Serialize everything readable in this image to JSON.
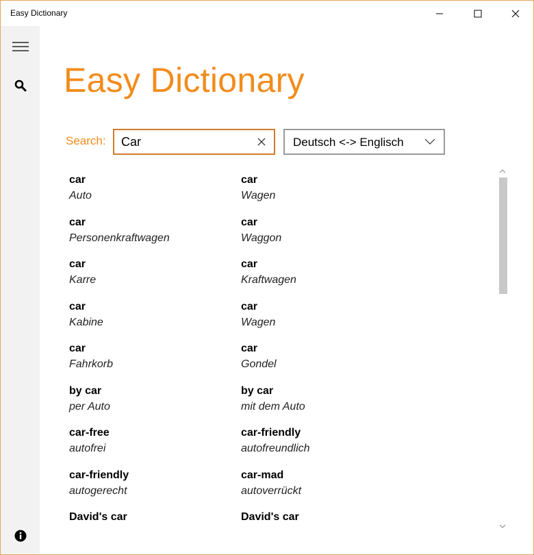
{
  "window": {
    "title": "Easy Dictionary"
  },
  "app": {
    "heading": "Easy Dictionary",
    "accent_color": "#f28c1c"
  },
  "sidebar": {
    "menu_icon": "hamburger-menu-icon",
    "search_icon": "search-icon",
    "info_icon": "info-icon"
  },
  "search": {
    "label": "Search:",
    "value": "Car",
    "clear_icon": "close-icon"
  },
  "language": {
    "selected": "Deutsch <-> Englisch"
  },
  "results": [
    {
      "left_term": "car",
      "left_translation": "Auto",
      "right_term": "car",
      "right_translation": "Wagen"
    },
    {
      "left_term": "car",
      "left_translation": "Personenkraftwagen",
      "right_term": "car",
      "right_translation": "Waggon"
    },
    {
      "left_term": "car",
      "left_translation": "Karre",
      "right_term": "car",
      "right_translation": "Kraftwagen"
    },
    {
      "left_term": "car",
      "left_translation": "Kabine",
      "right_term": "car",
      "right_translation": "Wagen"
    },
    {
      "left_term": "car",
      "left_translation": "Fahrkorb",
      "right_term": "car",
      "right_translation": "Gondel"
    },
    {
      "left_term": "by car",
      "left_translation": "per Auto",
      "right_term": "by car",
      "right_translation": "mit dem Auto"
    },
    {
      "left_term": "car-free",
      "left_translation": "autofrei",
      "right_term": "car-friendly",
      "right_translation": "autofreundlich"
    },
    {
      "left_term": "car-friendly",
      "left_translation": "autogerecht",
      "right_term": "car-mad",
      "right_translation": "autoverrückt"
    },
    {
      "left_term": "David's car",
      "left_translation": "",
      "right_term": "David's car",
      "right_translation": ""
    }
  ]
}
